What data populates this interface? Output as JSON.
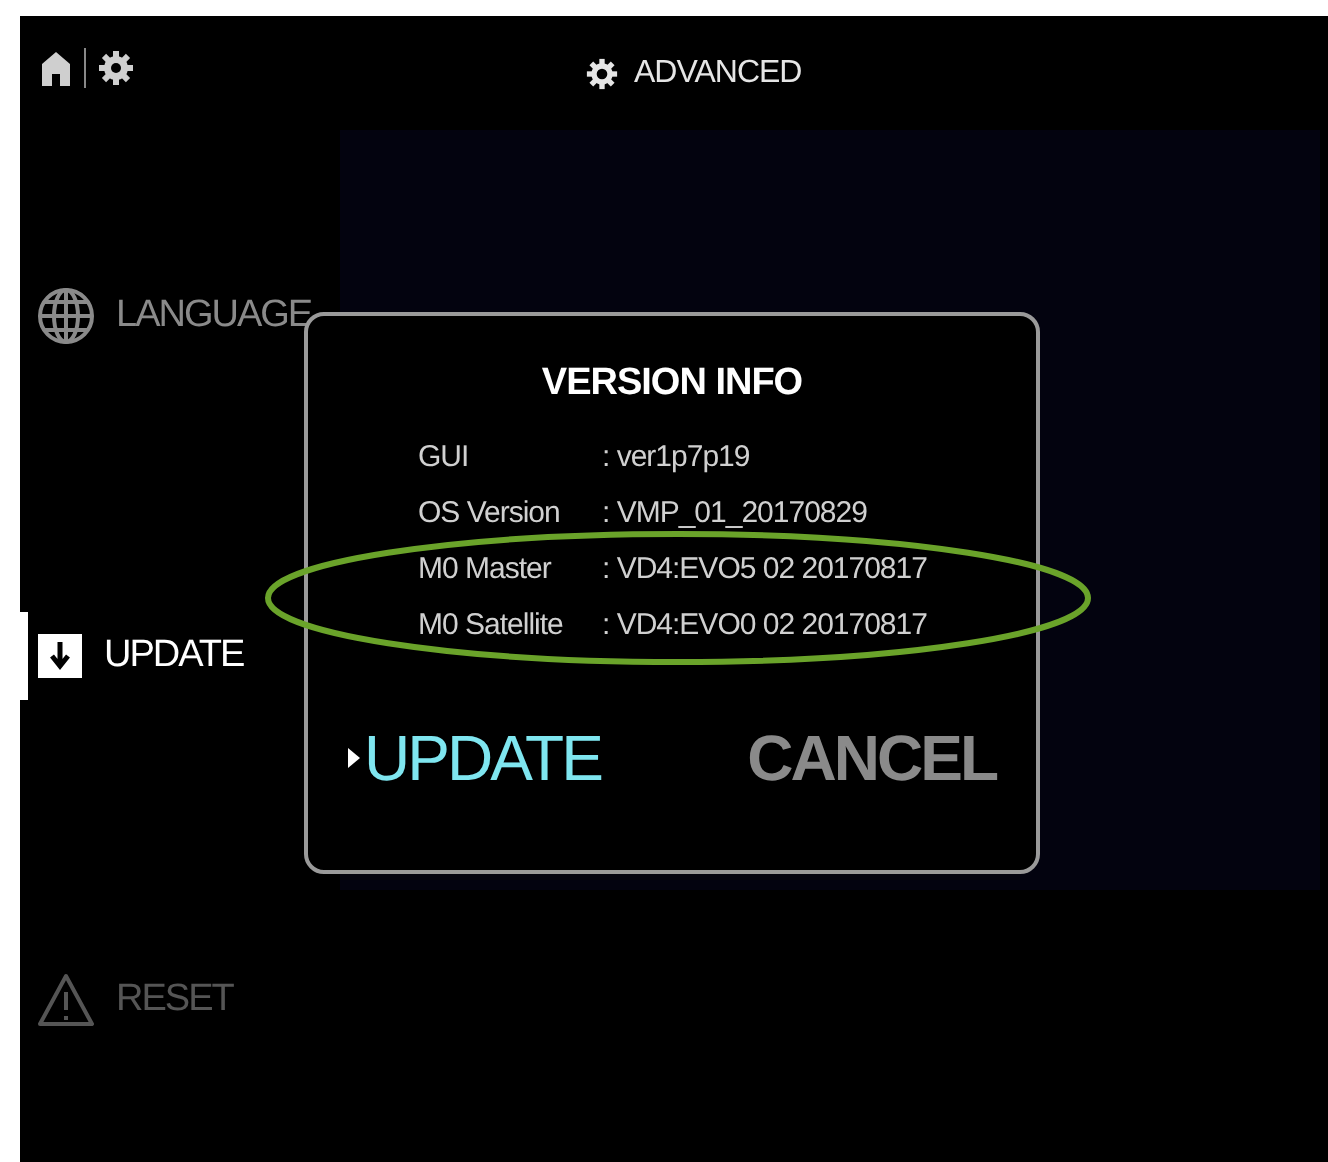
{
  "header": {
    "title": "ADVANCED"
  },
  "sidebar": {
    "items": [
      {
        "kind": "globe",
        "label": "LANGUAGE",
        "selected": false,
        "disabled": false
      },
      {
        "kind": "download",
        "label": "UPDATE",
        "selected": true,
        "disabled": false
      },
      {
        "kind": "warning",
        "label": "RESET",
        "selected": false,
        "disabled": true
      }
    ]
  },
  "dialog": {
    "title": "VERSION INFO",
    "rows": [
      {
        "label": "GUI",
        "value": ": ver1p7p19"
      },
      {
        "label": "OS Version",
        "value": ": VMP_01_20170829"
      },
      {
        "label": "M0 Master",
        "value": ": VD4:EVO5 02 20170817"
      },
      {
        "label": "M0 Satellite",
        "value": ": VD4:EVO0 02 20170817"
      }
    ],
    "buttons": [
      {
        "label": "UPDATE",
        "selected": true
      },
      {
        "label": "CANCEL",
        "selected": false
      }
    ]
  }
}
